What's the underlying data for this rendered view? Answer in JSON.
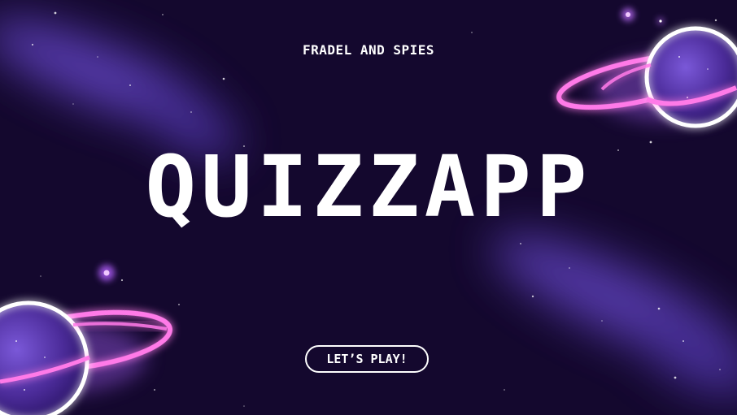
{
  "hero": {
    "brand": "FRADEL AND SPIES",
    "title": "QUIZZAPP",
    "cta_label": "LET’S PLAY!"
  },
  "icons": {
    "top_right": "ringed-planet-icon",
    "bottom_left": "ringed-planet-icon",
    "background": "galaxy-nebula"
  },
  "colors": {
    "background": "#14082e",
    "planet": "#5b3aa8",
    "neon_ring": "#ff7ae8",
    "nebula": "#6c4bd6",
    "text": "#ffffff"
  }
}
